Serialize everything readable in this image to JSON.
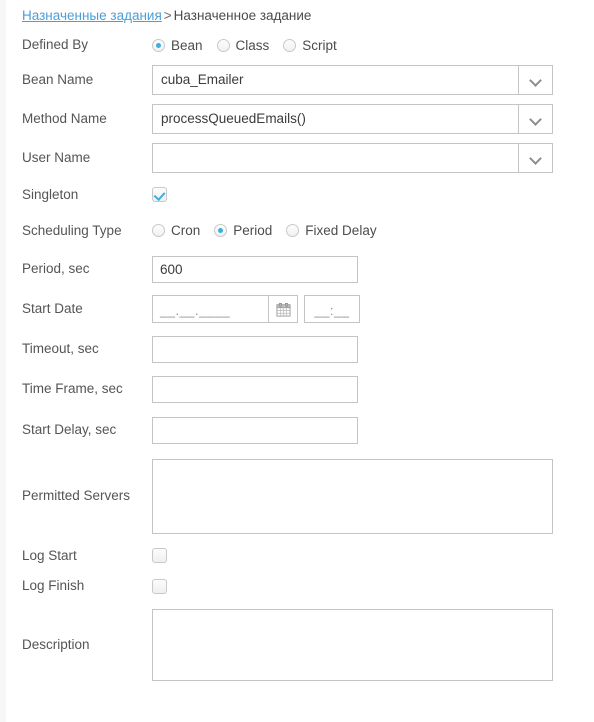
{
  "breadcrumb": {
    "parent": "Назначенные задания",
    "separator": ">",
    "current": "Назначенное задание",
    "link_color": "#4b9fd5"
  },
  "theme": {
    "accent": "#3eaede",
    "border": "#c4c4c4",
    "label_color": "#555555",
    "page_background": "#ffffff",
    "gutter": "#f7f7f7"
  },
  "form": {
    "defined_by": {
      "label": "Defined By",
      "options": [
        "Bean",
        "Class",
        "Script"
      ],
      "selected": "Bean"
    },
    "bean_name": {
      "label": "Bean Name",
      "value": "cuba_Emailer",
      "placeholder": ""
    },
    "method_name": {
      "label": "Method Name",
      "value": "processQueuedEmails()",
      "placeholder": ""
    },
    "user_name": {
      "label": "User Name",
      "value": "",
      "placeholder": ""
    },
    "singleton": {
      "label": "Singleton",
      "checked": true
    },
    "scheduling_type": {
      "label": "Scheduling Type",
      "options": [
        "Cron",
        "Period",
        "Fixed Delay"
      ],
      "selected": "Period"
    },
    "period_sec": {
      "label": "Period, sec",
      "value": "600"
    },
    "start_date": {
      "label": "Start Date",
      "date_mask": "__.__.____",
      "time_mask": "__:__",
      "calendar_icon": "calendar-icon"
    },
    "timeout_sec": {
      "label": "Timeout, sec",
      "value": ""
    },
    "time_frame_sec": {
      "label": "Time Frame, sec",
      "value": ""
    },
    "start_delay_sec": {
      "label": "Start Delay, sec",
      "value": ""
    },
    "permitted_servers": {
      "label": "Permitted Servers",
      "value": ""
    },
    "log_start": {
      "label": "Log Start",
      "checked": false
    },
    "log_finish": {
      "label": "Log Finish",
      "checked": false
    },
    "description": {
      "label": "Description",
      "value": ""
    }
  }
}
